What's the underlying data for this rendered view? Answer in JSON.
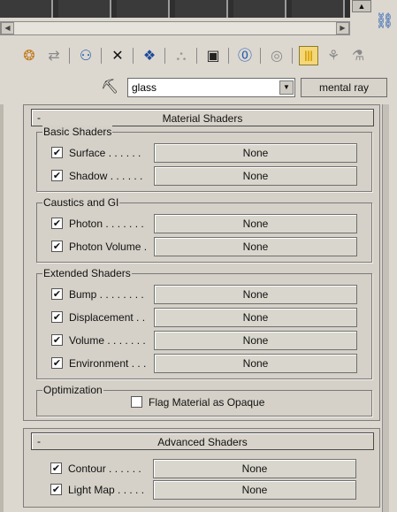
{
  "strip": {
    "scroll_up": "▲"
  },
  "hscroll": {
    "left": "◀",
    "right": "▶"
  },
  "toolbar": {
    "icons": [
      {
        "name": "get-material-icon",
        "glyph": "❂",
        "color": "#c27a1e"
      },
      {
        "name": "put-to-scene-icon",
        "glyph": "⇄",
        "color": "#8a8a8a"
      },
      {
        "name": "assign-to-selection-icon",
        "glyph": "⚇",
        "color": "#1e5ab4"
      },
      {
        "name": "reset-map-icon",
        "glyph": "✕",
        "color": "#111111"
      },
      {
        "name": "make-unique-icon",
        "glyph": "❖",
        "color": "#1e4a9c"
      },
      {
        "name": "put-to-library-icon",
        "glyph": "⛬",
        "color": "#9a9a9a"
      },
      {
        "name": "material-effects-channel-icon",
        "glyph": "▣",
        "color": "#222222"
      },
      {
        "name": "show-map-in-viewport-icon",
        "glyph": "⓪",
        "color": "#1e5ab4"
      },
      {
        "name": "show-end-result-icon",
        "glyph": "◎",
        "color": "#8a8a8a"
      },
      {
        "name": "go-to-parent-icon",
        "glyph": "Ⅲ",
        "color": "#d7a000"
      },
      {
        "name": "go-forward-to-sibling-icon",
        "glyph": "⚘",
        "color": "#8a8a8a"
      },
      {
        "name": "pick-material-icon",
        "glyph": "⚗",
        "color": "#8a8a8a"
      }
    ]
  },
  "name_row": {
    "material_name": "glass",
    "dropdown_arrow": "▼",
    "material_type": "mental ray"
  },
  "material_shaders": {
    "minus": "-",
    "title": "Material Shaders",
    "groups": [
      {
        "label": "Basic Shaders",
        "rows": [
          {
            "label": "Surface . . . . . .",
            "checked": "✔",
            "value": "None"
          },
          {
            "label": "Shadow . . . . . .",
            "checked": "✔",
            "value": "None"
          }
        ]
      },
      {
        "label": "Caustics and GI",
        "rows": [
          {
            "label": "Photon . . . . . . .",
            "checked": "✔",
            "value": "None"
          },
          {
            "label": "Photon Volume .",
            "checked": "✔",
            "value": "None"
          }
        ]
      },
      {
        "label": "Extended Shaders",
        "rows": [
          {
            "label": "Bump . . . . . . . .",
            "checked": "✔",
            "value": "None"
          },
          {
            "label": "Displacement . .",
            "checked": "✔",
            "value": "None"
          },
          {
            "label": "Volume . . . . . . .",
            "checked": "✔",
            "value": "None"
          },
          {
            "label": "Environment . . .",
            "checked": "✔",
            "value": "None"
          }
        ]
      }
    ],
    "optimization": {
      "label": "Optimization",
      "flag_label": "Flag Material as Opaque",
      "flag_checked": ""
    }
  },
  "advanced_shaders": {
    "minus": "-",
    "title": "Advanced Shaders",
    "rows": [
      {
        "label": "Contour . . . . . .",
        "checked": "✔",
        "value": "None"
      },
      {
        "label": "Light Map . . . . .",
        "checked": "✔",
        "value": "None"
      }
    ]
  }
}
